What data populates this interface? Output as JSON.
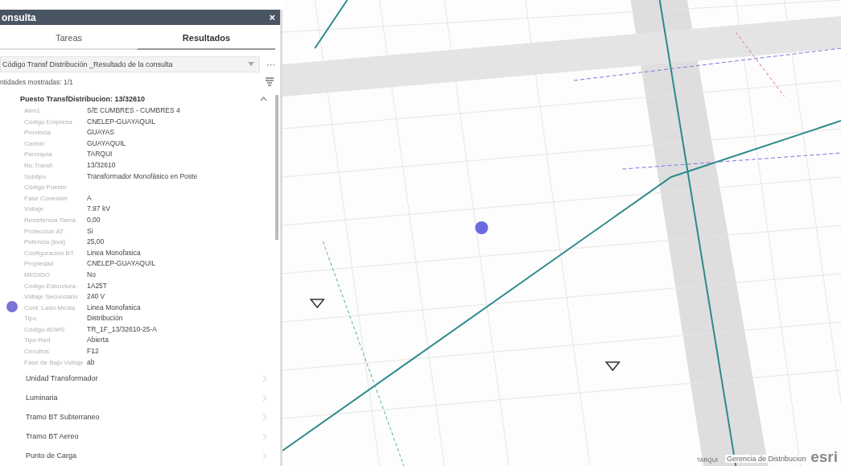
{
  "panel": {
    "title": "onsulta",
    "close": "×",
    "tabs": [
      {
        "label": "Tareas",
        "selected": false
      },
      {
        "label": "Resultados",
        "selected": true
      }
    ],
    "layer_select": {
      "value": "Código Transf Distribución _Resultado de la consulta"
    },
    "more": "···",
    "count": "ntidades mostradas: 1/1",
    "feature": {
      "title": "Puesto TransfDistribucion: 13/32610",
      "expanded": true,
      "fields": [
        {
          "label": "Alim1",
          "value": "S/E CUMBRES - CUMBRES 4"
        },
        {
          "label": "Código Empresa",
          "value": "CNELEP-GUAYAQUIL"
        },
        {
          "label": "Provincia",
          "value": "GUAYAS"
        },
        {
          "label": "Cantón",
          "value": "GUAYAQUIL"
        },
        {
          "label": "Parroquia",
          "value": "TARQUI"
        },
        {
          "label": "No.Transf.",
          "value": "13/32610"
        },
        {
          "label": "Subtipo",
          "value": "Transformador Monofásico en Poste"
        },
        {
          "label": "Código Puesto"
        },
        {
          "label": "Fase Conexión",
          "value": "A"
        },
        {
          "label": "Voltaje",
          "value": "7.97 kV"
        },
        {
          "label": "Resistencia Tierra",
          "value": "0,00"
        },
        {
          "label": "Proteccion AT",
          "value": "Si"
        },
        {
          "label": "Potencia (kva)",
          "value": "25,00"
        },
        {
          "label": "Configuración BT",
          "value": "Linea Monofasica"
        },
        {
          "label": "Propiedad",
          "value": "CNELEP-GUAYAQUIL"
        },
        {
          "label": "MEDIDO",
          "value": "No"
        },
        {
          "label": "Codigo Estructura",
          "value": "1A25T"
        },
        {
          "label": "Voltaje Secundario",
          "value": "240 V"
        },
        {
          "label": "Conf. Lado Media",
          "value": "Linea Monofasica"
        },
        {
          "label": "Tipo",
          "value": "Distribución"
        },
        {
          "label": "Código ADMS",
          "value": "TR_1F_13/32610-25-A"
        },
        {
          "label": "Tipo Red",
          "value": "Abierta"
        },
        {
          "label": "Circuitos",
          "value": "F12"
        },
        {
          "label": "Fase de Bajo Voltaje",
          "value": "ab"
        }
      ]
    },
    "related": [
      "Unidad Transformador",
      "Luminaria",
      "Tramo BT Subterraneo",
      "Tramo BT Aereo",
      "Punto de Carga"
    ]
  },
  "map": {
    "place_label": "TARQUI",
    "attribution": "Gerencia de Distribucion",
    "logo": "esri"
  }
}
